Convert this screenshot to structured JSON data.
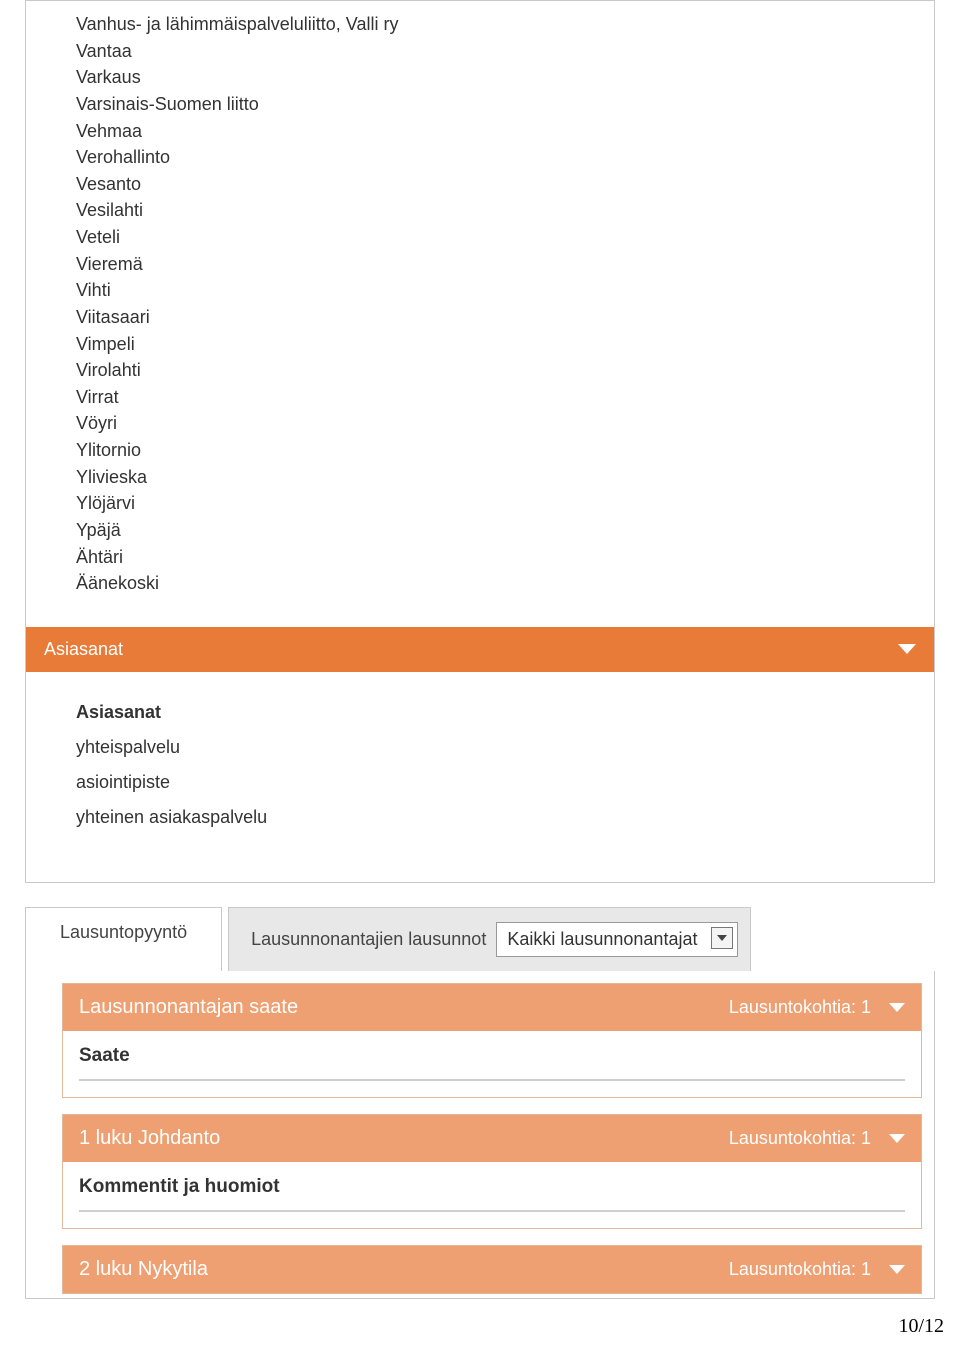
{
  "list_items": [
    "Vanhus- ja lähimmäispalveluliitto, Valli ry",
    "Vantaa",
    "Varkaus",
    "Varsinais-Suomen liitto",
    "Vehmaa",
    "Verohallinto",
    "Vesanto",
    "Vesilahti",
    "Veteli",
    "Vieremä",
    "Vihti",
    "Viitasaari",
    "Vimpeli",
    "Virolahti",
    "Virrat",
    "Vöyri",
    "Ylitornio",
    "Ylivieska",
    "Ylöjärvi",
    "Ypäjä",
    "Ähtäri",
    "Äänekoski"
  ],
  "asiasanat": {
    "bar_title": "Asiasanat",
    "heading": "Asiasanat",
    "keywords": [
      "yhteispalvelu",
      "asiointipiste",
      "yhteinen asiakaspalvelu"
    ]
  },
  "tabs": {
    "active": "Lausuntopyyntö",
    "inactive_label": "Lausunnonantajien lausunnot",
    "dropdown_value": "Kaikki lausunnonantajat"
  },
  "sections": [
    {
      "title": "Lausunnonantajan saate",
      "count_label": "Lausuntokohtia: 1",
      "body_label": "Saate",
      "expanded": true
    },
    {
      "title": "1 luku Johdanto",
      "count_label": "Lausuntokohtia: 1",
      "body_label": "Kommentit ja huomiot",
      "expanded": true
    },
    {
      "title": "2 luku Nykytila",
      "count_label": "Lausuntokohtia: 1",
      "body_label": "",
      "expanded": false
    }
  ],
  "page_number": "10/12"
}
